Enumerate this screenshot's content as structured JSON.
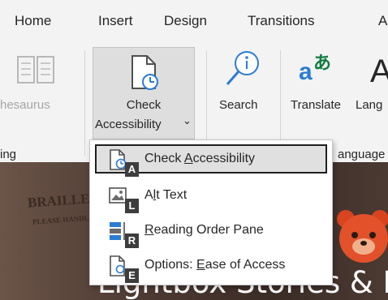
{
  "tabs": [
    "Home",
    "Insert",
    "Design",
    "Transitions",
    "A"
  ],
  "ribbon": {
    "thesaurus_label": "hesaurus",
    "check_label_1": "Check",
    "check_label_2": "Accessibility",
    "check_caret": "⌄",
    "search_label": "Search",
    "translate_label": "Translate",
    "language_label": "Lang",
    "translate_glyph_a": "a",
    "translate_glyph_b": "あ",
    "translate_glyph_c": "A",
    "group_left": "ing",
    "group_language": "anguage"
  },
  "menu": {
    "items": [
      {
        "pre": "Check ",
        "accel": "A",
        "post": "ccessibility",
        "key": "A",
        "icon": "check-accessibility-icon"
      },
      {
        "pre": "A",
        "accel": "l",
        "post": "t Text",
        "key": "L",
        "icon": "alt-text-icon"
      },
      {
        "pre": "",
        "accel": "R",
        "post": "eading Order Pane",
        "key": "R",
        "icon": "reading-order-pane-icon"
      },
      {
        "pre": "Options: ",
        "accel": "E",
        "post": "ase of Access",
        "key": "E",
        "icon": "ease-of-access-options-icon"
      }
    ]
  },
  "slide": {
    "title": "Lightbox Stories & Li",
    "box_text_1": "BRAILLE",
    "box_text_2": "PLEASE HANDLE"
  },
  "colors": {
    "ribbon_bg": "#f3f3f3",
    "button_pressed": "#dedede",
    "accent_blue": "#2b7cd3",
    "translate_green": "#107c41"
  }
}
